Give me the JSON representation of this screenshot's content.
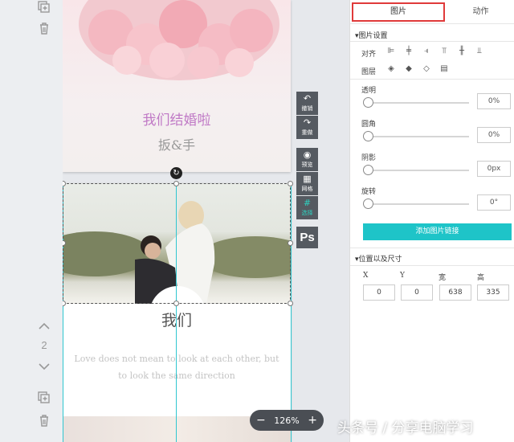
{
  "canvas": {
    "page1": {
      "title": "我们结婚啦",
      "subtitle": "扳&手"
    },
    "page2": {
      "title": "我们",
      "quote": "Love does not mean to look at each other, but to look the same direction"
    }
  },
  "pager": {
    "current": "2"
  },
  "tools": [
    {
      "label": "撤销",
      "icon": "undo-icon"
    },
    {
      "label": "重做",
      "icon": "redo-icon"
    },
    {
      "label": "预览",
      "icon": "eye-icon"
    },
    {
      "label": "网格",
      "icon": "grid-icon"
    },
    {
      "label": "选择",
      "icon": "hash-icon"
    }
  ],
  "ps_label": "Ps",
  "zoom": {
    "minus": "−",
    "value": "126%",
    "plus": "+"
  },
  "panel": {
    "tabs": {
      "image": "图片",
      "action": "动作"
    },
    "image_settings": "▾图片设置",
    "align_label": "对齐",
    "layer_label": "图层",
    "opacity": {
      "label": "透明",
      "value": "0%"
    },
    "radius": {
      "label": "圆角",
      "value": "0%"
    },
    "shadow": {
      "label": "阴影",
      "value": "0px"
    },
    "rotate": {
      "label": "旋转",
      "value": "0°"
    },
    "add_link": "添加图片链接",
    "pos_size": "▾位置以及尺寸",
    "x_label": "X",
    "y_label": "Y",
    "w_label": "宽",
    "h_label": "高",
    "x": "0",
    "y": "0",
    "w": "638",
    "h": "335"
  },
  "watermark": "头条号 / 分享电脑学习"
}
